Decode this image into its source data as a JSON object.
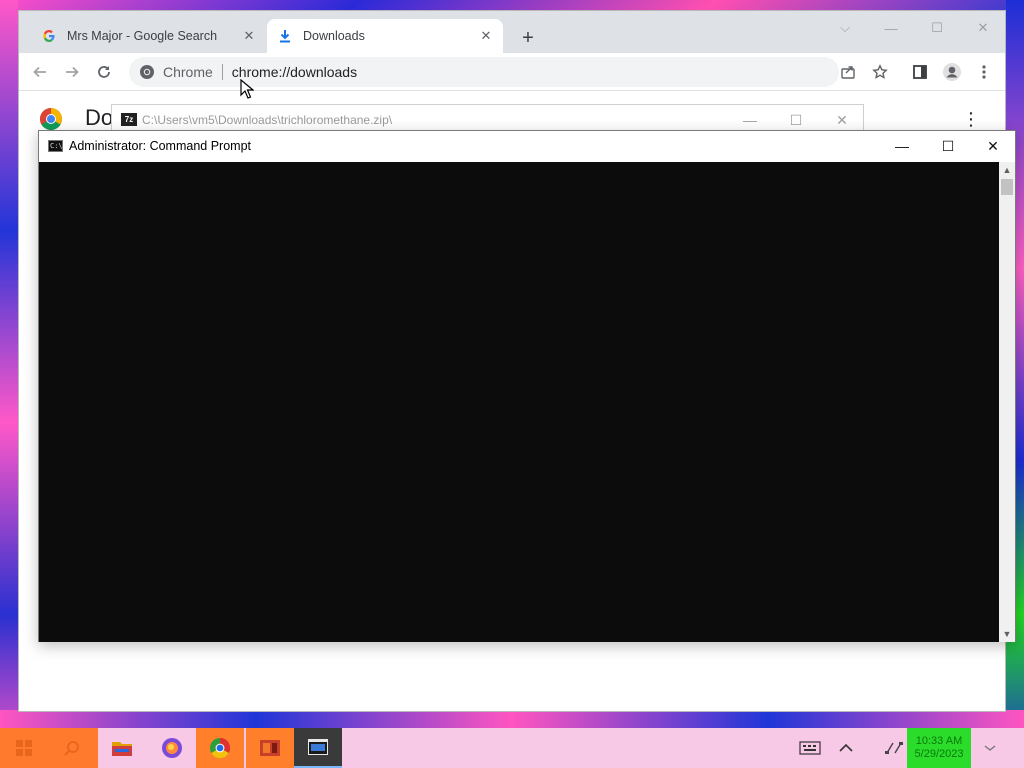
{
  "browser": {
    "tabs": [
      {
        "title": "Mrs Major - Google Search",
        "favicon": "google-g-icon",
        "active": false
      },
      {
        "title": "Downloads",
        "favicon": "download-icon",
        "active": true
      }
    ],
    "new_tab_label": "+",
    "omnibox": {
      "chip_label": "Chrome",
      "url": "chrome://downloads"
    },
    "page_title": "Do"
  },
  "zip_window": {
    "icon_label": "7z",
    "title": "C:\\Users\\vm5\\Downloads\\trichloromethane.zip\\"
  },
  "cmd_window": {
    "icon_label": "C:\\",
    "title": "Administrator:  Command Prompt"
  },
  "taskbar": {
    "clock_time": "10:33 AM",
    "clock_date": "5/29/2023"
  },
  "colors": {
    "desktop_pink": "#ff4fc8",
    "desktop_blue": "#2a2ad8",
    "console_bg": "#0c0c0c",
    "taskbar_bg": "#f7c9e6",
    "clock_bg": "#2bdc2b"
  }
}
